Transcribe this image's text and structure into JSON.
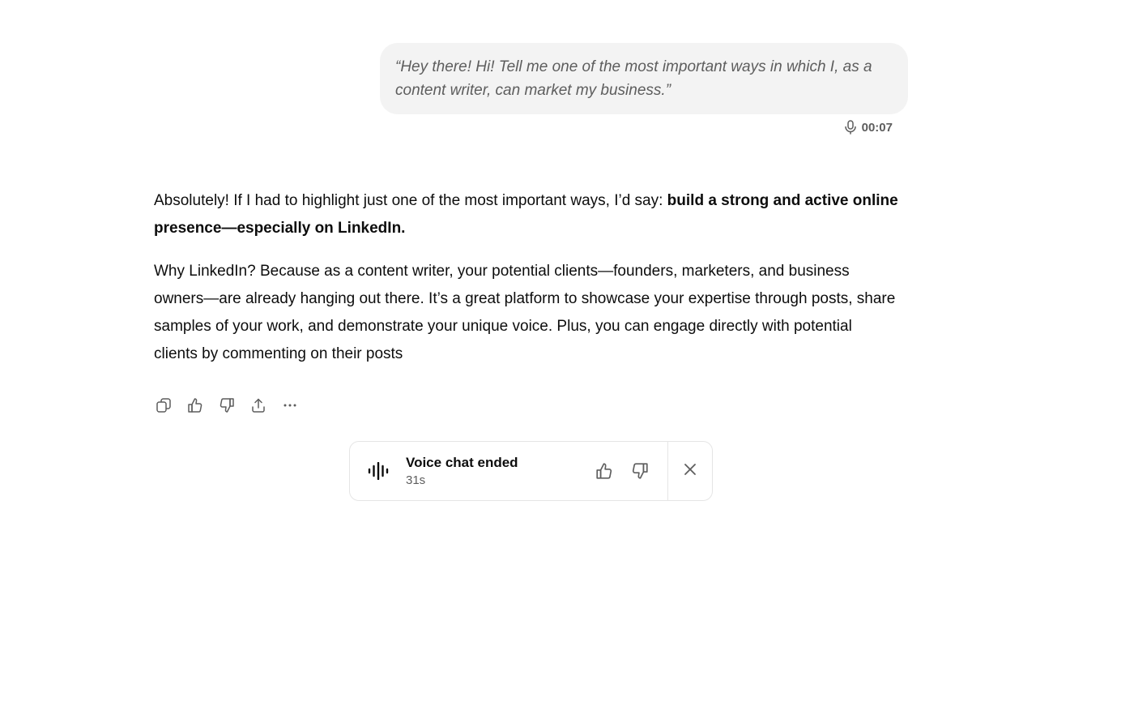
{
  "user_message": {
    "text": "“Hey there! Hi! Tell me one of the most important ways in which I, as a content writer, can market my business.”",
    "duration": "00:07",
    "mic_icon": "microphone-icon"
  },
  "assistant_message": {
    "p1_plain": "Absolutely! If I had to highlight just one of the most important ways, I’d say: ",
    "p1_bold": "build a strong and active online presence—especially on LinkedIn.",
    "p2": "Why LinkedIn? Because as a content writer, your potential clients—founders, marketers, and business owners—are already hanging out there. It’s a great platform to showcase your expertise through posts, share samples of your work, and demonstrate your unique voice. Plus, you can engage directly with potential clients by commenting on their posts"
  },
  "actions": {
    "copy_icon": "copy-icon",
    "thumbs_up_icon": "thumbs-up-icon",
    "thumbs_down_icon": "thumbs-down-icon",
    "share_icon": "share-icon",
    "more_icon": "more-icon"
  },
  "voice_card": {
    "title": "Voice chat ended",
    "duration": "31s",
    "icon": "waveform-icon",
    "close_icon": "close-icon"
  },
  "colors": {
    "bubble_bg": "#f3f3f3",
    "text_primary": "#0d0d0d",
    "text_secondary": "#5d5d5d",
    "border": "#e5e5e5"
  }
}
